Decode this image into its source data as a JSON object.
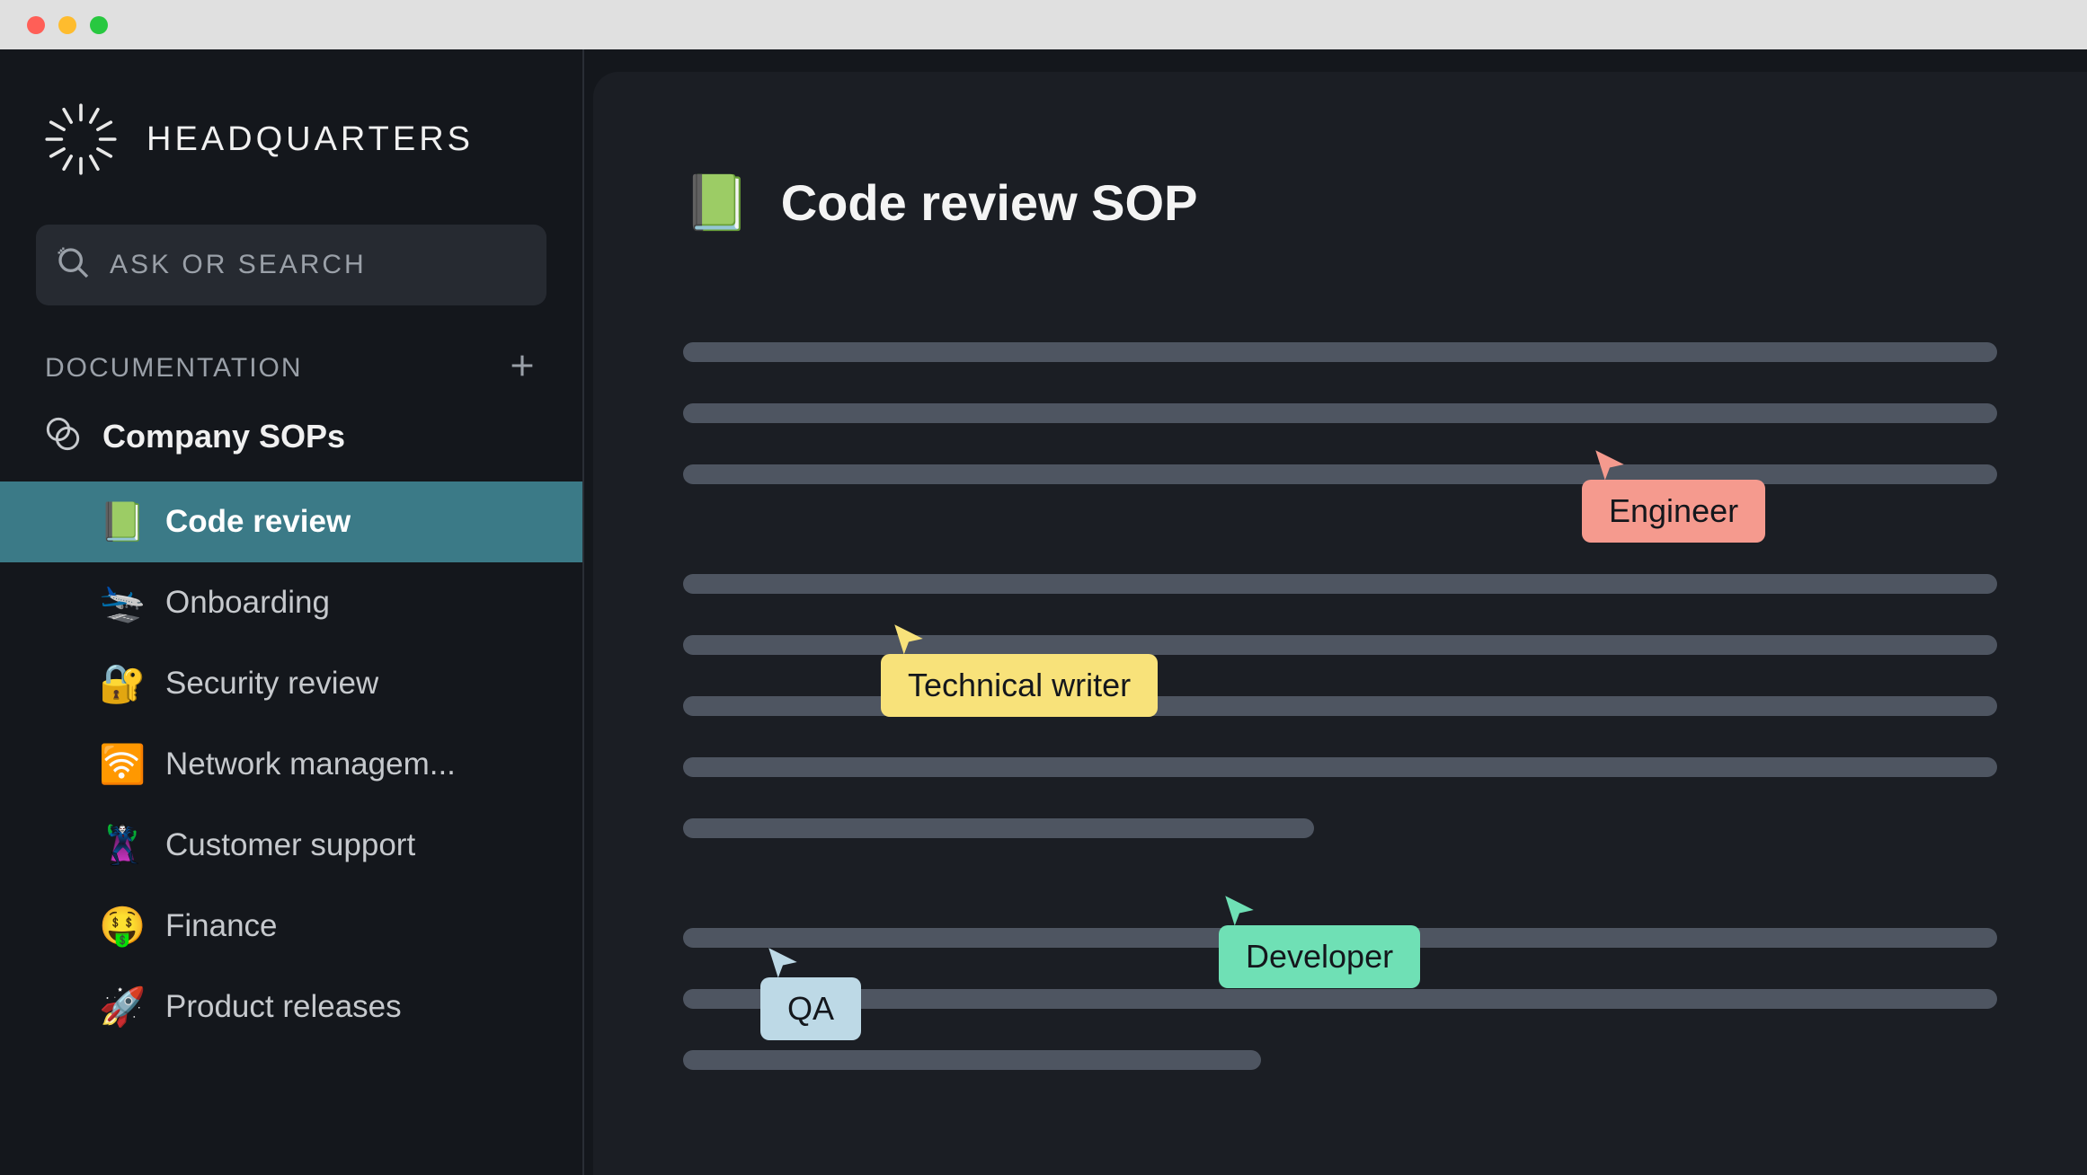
{
  "brand": {
    "title": "HEADQUARTERS"
  },
  "search": {
    "placeholder": "ASK OR SEARCH"
  },
  "sidebar": {
    "section_label": "DOCUMENTATION",
    "space_label": "Company SOPs",
    "items": [
      {
        "emoji": "📗",
        "label": "Code review",
        "active": true
      },
      {
        "emoji": "🛬",
        "label": "Onboarding",
        "active": false
      },
      {
        "emoji": "🔐",
        "label": "Security review",
        "active": false
      },
      {
        "emoji": "🛜",
        "label": "Network managem...",
        "active": false
      },
      {
        "emoji": "🦹",
        "label": "Customer support",
        "active": false
      },
      {
        "emoji": "🤑",
        "label": "Finance",
        "active": false
      },
      {
        "emoji": "🚀",
        "label": "Product releases",
        "active": false
      }
    ]
  },
  "page": {
    "emoji": "📗",
    "title": "Code review SOP"
  },
  "cursors": {
    "engineer": "Engineer",
    "writer": "Technical writer",
    "developer": "Developer",
    "qa": "QA"
  },
  "colors": {
    "engineer": "#f59a8e",
    "writer": "#f8e27a",
    "developer": "#6fe0b5",
    "qa": "#bdd9e6",
    "sidebar_active": "#3b7a87",
    "skeleton": "#4e5561"
  }
}
